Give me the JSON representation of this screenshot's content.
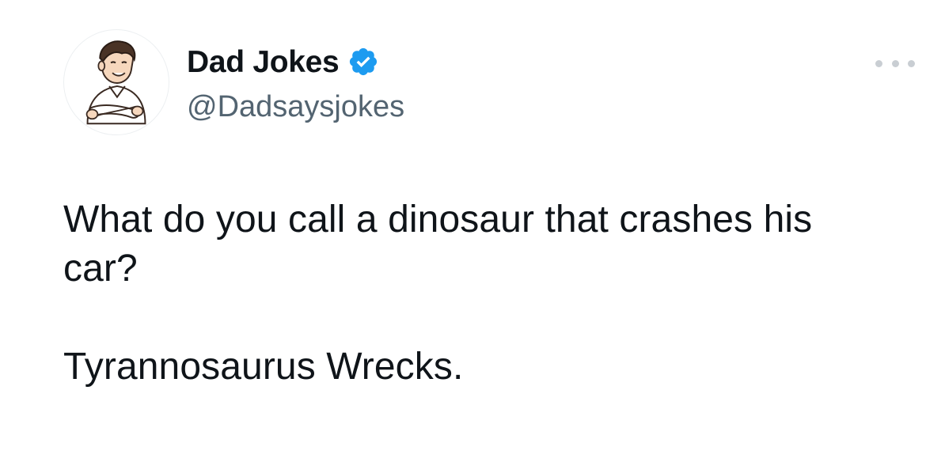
{
  "author": {
    "display_name": "Dad Jokes",
    "handle": "@Dadsaysjokes",
    "verified": true,
    "verified_color": "#1d9bf0",
    "avatar_icon": "cartoon-dad-avatar"
  },
  "tweet": {
    "question_line1": "What do you call a dinosaur that crashes his",
    "question_line2": "car?",
    "answer": "Tyrannosaurus Wrecks."
  },
  "menu": {
    "icon": "more-options-icon"
  },
  "colors": {
    "text_primary": "#0f1419",
    "text_secondary": "#536471",
    "background": "#ffffff"
  }
}
